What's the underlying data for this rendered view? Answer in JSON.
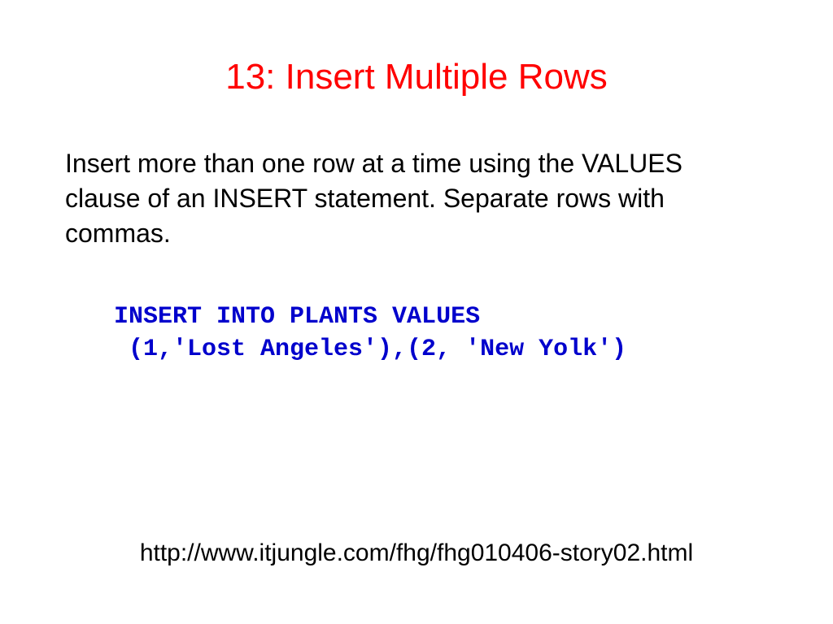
{
  "slide": {
    "title": "13: Insert Multiple Rows",
    "body": "Insert more than one row at a time using the VALUES clause of an INSERT statement. Separate rows with commas.",
    "code": "INSERT INTO PLANTS VALUES\n (1,'Lost Angeles'),(2, 'New Yolk')",
    "link": "http://www.itjungle.com/fhg/fhg010406-story02.html"
  },
  "colors": {
    "title": "#ff0000",
    "body": "#000000",
    "code": "#0000cc"
  }
}
